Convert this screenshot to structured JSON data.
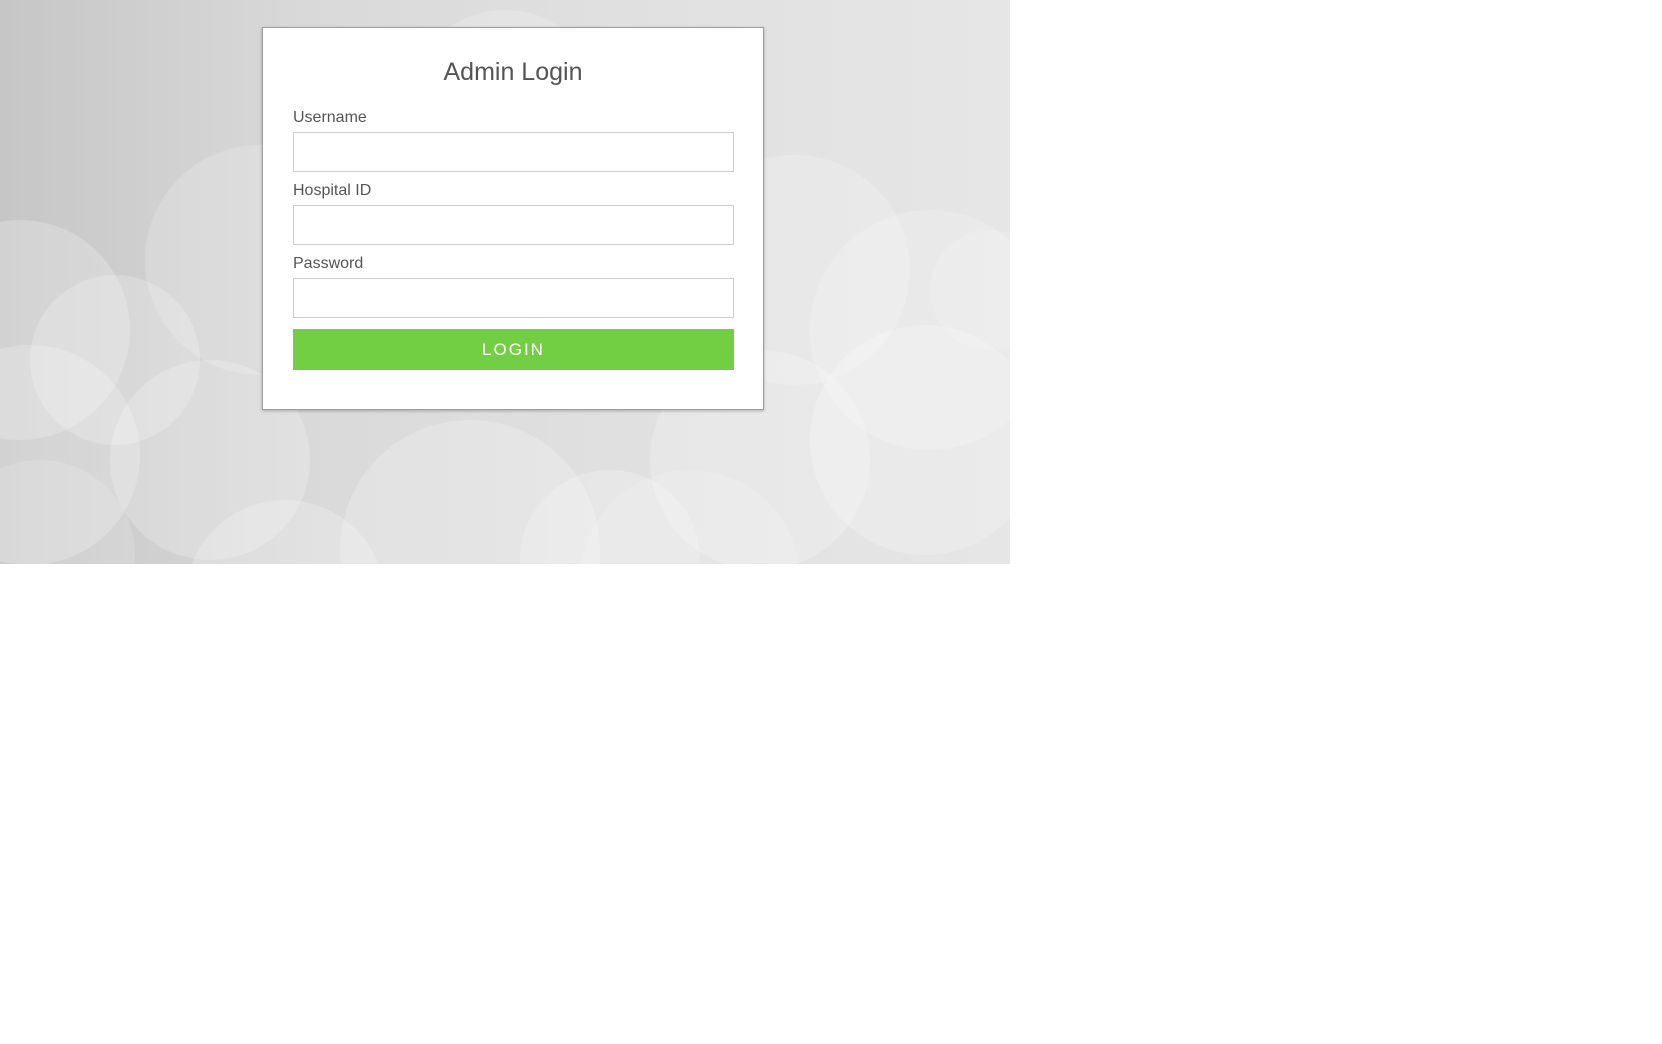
{
  "login": {
    "title": "Admin Login",
    "username_label": "Username",
    "username_value": "",
    "hospital_id_label": "Hospital ID",
    "hospital_id_value": "",
    "password_label": "Password",
    "password_value": "",
    "login_button_label": "LOGIN"
  },
  "colors": {
    "accent": "#72cf44",
    "background": "#d9d9d9",
    "text": "#555555"
  }
}
